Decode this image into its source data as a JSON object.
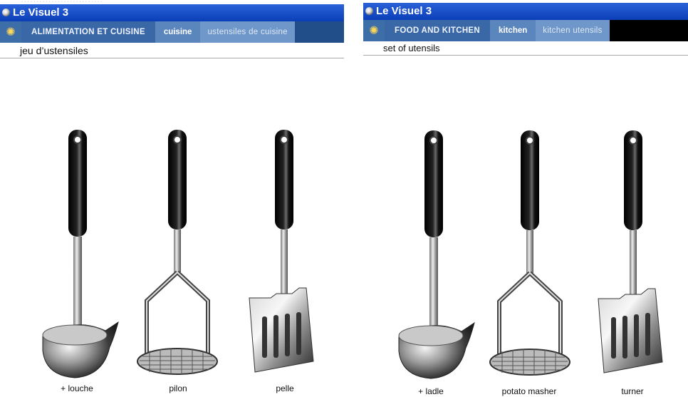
{
  "french": {
    "window_title": "Le Visuel 3",
    "nav": {
      "category": "ALIMENTATION ET CUISINE",
      "subcategory": "cuisine",
      "subsubcategory": "ustensiles de cuisine"
    },
    "heading": "jeu d’ustensiles",
    "items": [
      {
        "label": "+ louche",
        "icon": "ladle-icon"
      },
      {
        "label": "pilon",
        "icon": "potato-masher-icon"
      },
      {
        "label": "pelle",
        "icon": "turner-icon"
      }
    ]
  },
  "english": {
    "window_title": "Le Visuel 3",
    "nav": {
      "category": "FOOD AND KITCHEN",
      "subcategory": "kitchen",
      "subsubcategory": "kitchen utensils"
    },
    "heading": "set of utensils",
    "items": [
      {
        "label": "+ ladle",
        "icon": "ladle-icon"
      },
      {
        "label": "potato masher",
        "icon": "potato-masher-icon"
      },
      {
        "label": "turner",
        "icon": "turner-icon"
      }
    ]
  },
  "colors": {
    "titlebar": "#0b3fb8",
    "nav_dark": "#214d88",
    "nav_category": "#3a68a6",
    "nav_sub": "#5a86bd"
  }
}
